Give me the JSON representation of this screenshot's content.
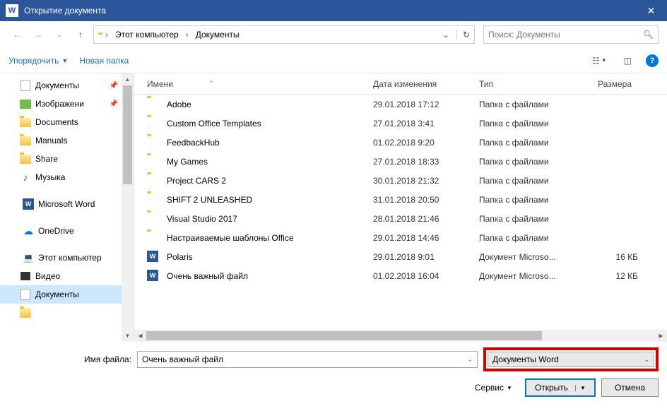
{
  "titlebar": {
    "title": "Открытие документа"
  },
  "nav": {
    "crumb1": "Этот компьютер",
    "crumb2": "Документы"
  },
  "search": {
    "placeholder": "Поиск: Документы"
  },
  "toolbar": {
    "organize": "Упорядочить",
    "newfolder": "Новая папка"
  },
  "sidebar": {
    "items": [
      {
        "label": "Документы",
        "type": "doc",
        "pin": true
      },
      {
        "label": "Изображени",
        "type": "img",
        "pin": true
      },
      {
        "label": "Documents",
        "type": "folder"
      },
      {
        "label": "Manuals",
        "type": "folder"
      },
      {
        "label": "Share",
        "type": "folder"
      },
      {
        "label": "Музыка",
        "type": "music"
      }
    ],
    "word": "Microsoft Word",
    "onedrive": "OneDrive",
    "thispc": "Этот компьютер",
    "video": "Видео",
    "documents": "Документы"
  },
  "columns": {
    "name": "Имени",
    "date": "Дата изменения",
    "type": "Тип",
    "size": "Размера"
  },
  "rows": [
    {
      "name": "Adobe",
      "date": "29.01.2018 17:12",
      "type": "Папка с файлами",
      "size": "",
      "kind": "folder"
    },
    {
      "name": "Custom Office Templates",
      "date": "27.01.2018 3:41",
      "type": "Папка с файлами",
      "size": "",
      "kind": "folder"
    },
    {
      "name": "FeedbackHub",
      "date": "01.02.2018 9:20",
      "type": "Папка с файлами",
      "size": "",
      "kind": "folder"
    },
    {
      "name": "My Games",
      "date": "27.01.2018 18:33",
      "type": "Папка с файлами",
      "size": "",
      "kind": "folder"
    },
    {
      "name": "Project CARS 2",
      "date": "30.01.2018 21:32",
      "type": "Папка с файлами",
      "size": "",
      "kind": "folder"
    },
    {
      "name": "SHIFT 2 UNLEASHED",
      "date": "31.01.2018 20:50",
      "type": "Папка с файлами",
      "size": "",
      "kind": "folder"
    },
    {
      "name": "Visual Studio 2017",
      "date": "28.01.2018 21:46",
      "type": "Папка с файлами",
      "size": "",
      "kind": "folder"
    },
    {
      "name": "Настраиваемые шаблоны Office",
      "date": "29.01.2018 14:46",
      "type": "Папка с файлами",
      "size": "",
      "kind": "folder"
    },
    {
      "name": "Polaris",
      "date": "29.01.2018 9:01",
      "type": "Документ Microso...",
      "size": "16 КБ",
      "kind": "word"
    },
    {
      "name": "Очень важный файл",
      "date": "01.02.2018 16:04",
      "type": "Документ Microso...",
      "size": "12 КБ",
      "kind": "word"
    }
  ],
  "footer": {
    "filename_label": "Имя файла:",
    "filename_value": "Очень важный файл",
    "filter_value": "Документы Word",
    "service": "Сервис",
    "open": "Открыть",
    "cancel": "Отмена"
  }
}
